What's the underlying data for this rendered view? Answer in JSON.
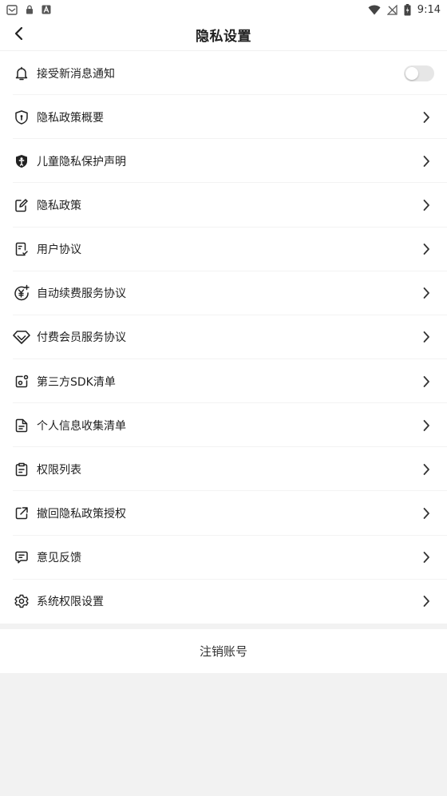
{
  "status_bar": {
    "time": "9:14",
    "left_icons": [
      "mail-icon",
      "lock-icon",
      "a-notification-icon"
    ],
    "right_icons": [
      "wifi-icon",
      "no-signal-icon",
      "battery-charging-icon"
    ]
  },
  "header": {
    "title": "隐私设置",
    "back_icon": "chevron-left-icon"
  },
  "settings": {
    "items": [
      {
        "label": "接受新消息通知",
        "icon": "bell-icon",
        "control": "toggle",
        "toggle_on": false
      },
      {
        "label": "隐私政策概要",
        "icon": "shield-icon",
        "control": "chevron"
      },
      {
        "label": "儿童隐私保护声明",
        "icon": "child-shield-icon",
        "control": "chevron"
      },
      {
        "label": "隐私政策",
        "icon": "edit-document-icon",
        "control": "chevron"
      },
      {
        "label": "用户协议",
        "icon": "user-agreement-icon",
        "control": "chevron"
      },
      {
        "label": "自动续费服务协议",
        "icon": "yuan-renew-icon",
        "control": "chevron"
      },
      {
        "label": "付费会员服务协议",
        "icon": "diamond-icon",
        "control": "chevron"
      },
      {
        "label": "第三方SDK清单",
        "icon": "third-party-icon",
        "control": "chevron"
      },
      {
        "label": "个人信息收集清单",
        "icon": "document-list-icon",
        "control": "chevron"
      },
      {
        "label": "权限列表",
        "icon": "permission-list-icon",
        "control": "chevron"
      },
      {
        "label": "撤回隐私政策授权",
        "icon": "revoke-share-icon",
        "control": "chevron"
      },
      {
        "label": "意见反馈",
        "icon": "feedback-icon",
        "control": "chevron"
      },
      {
        "label": "系统权限设置",
        "icon": "gear-icon",
        "control": "chevron"
      }
    ]
  },
  "deregister": {
    "label": "注销账号"
  },
  "colors": {
    "background": "#f2f2f2",
    "surface": "#ffffff",
    "text": "#222222",
    "toggle_off": "#e6e6e6"
  }
}
